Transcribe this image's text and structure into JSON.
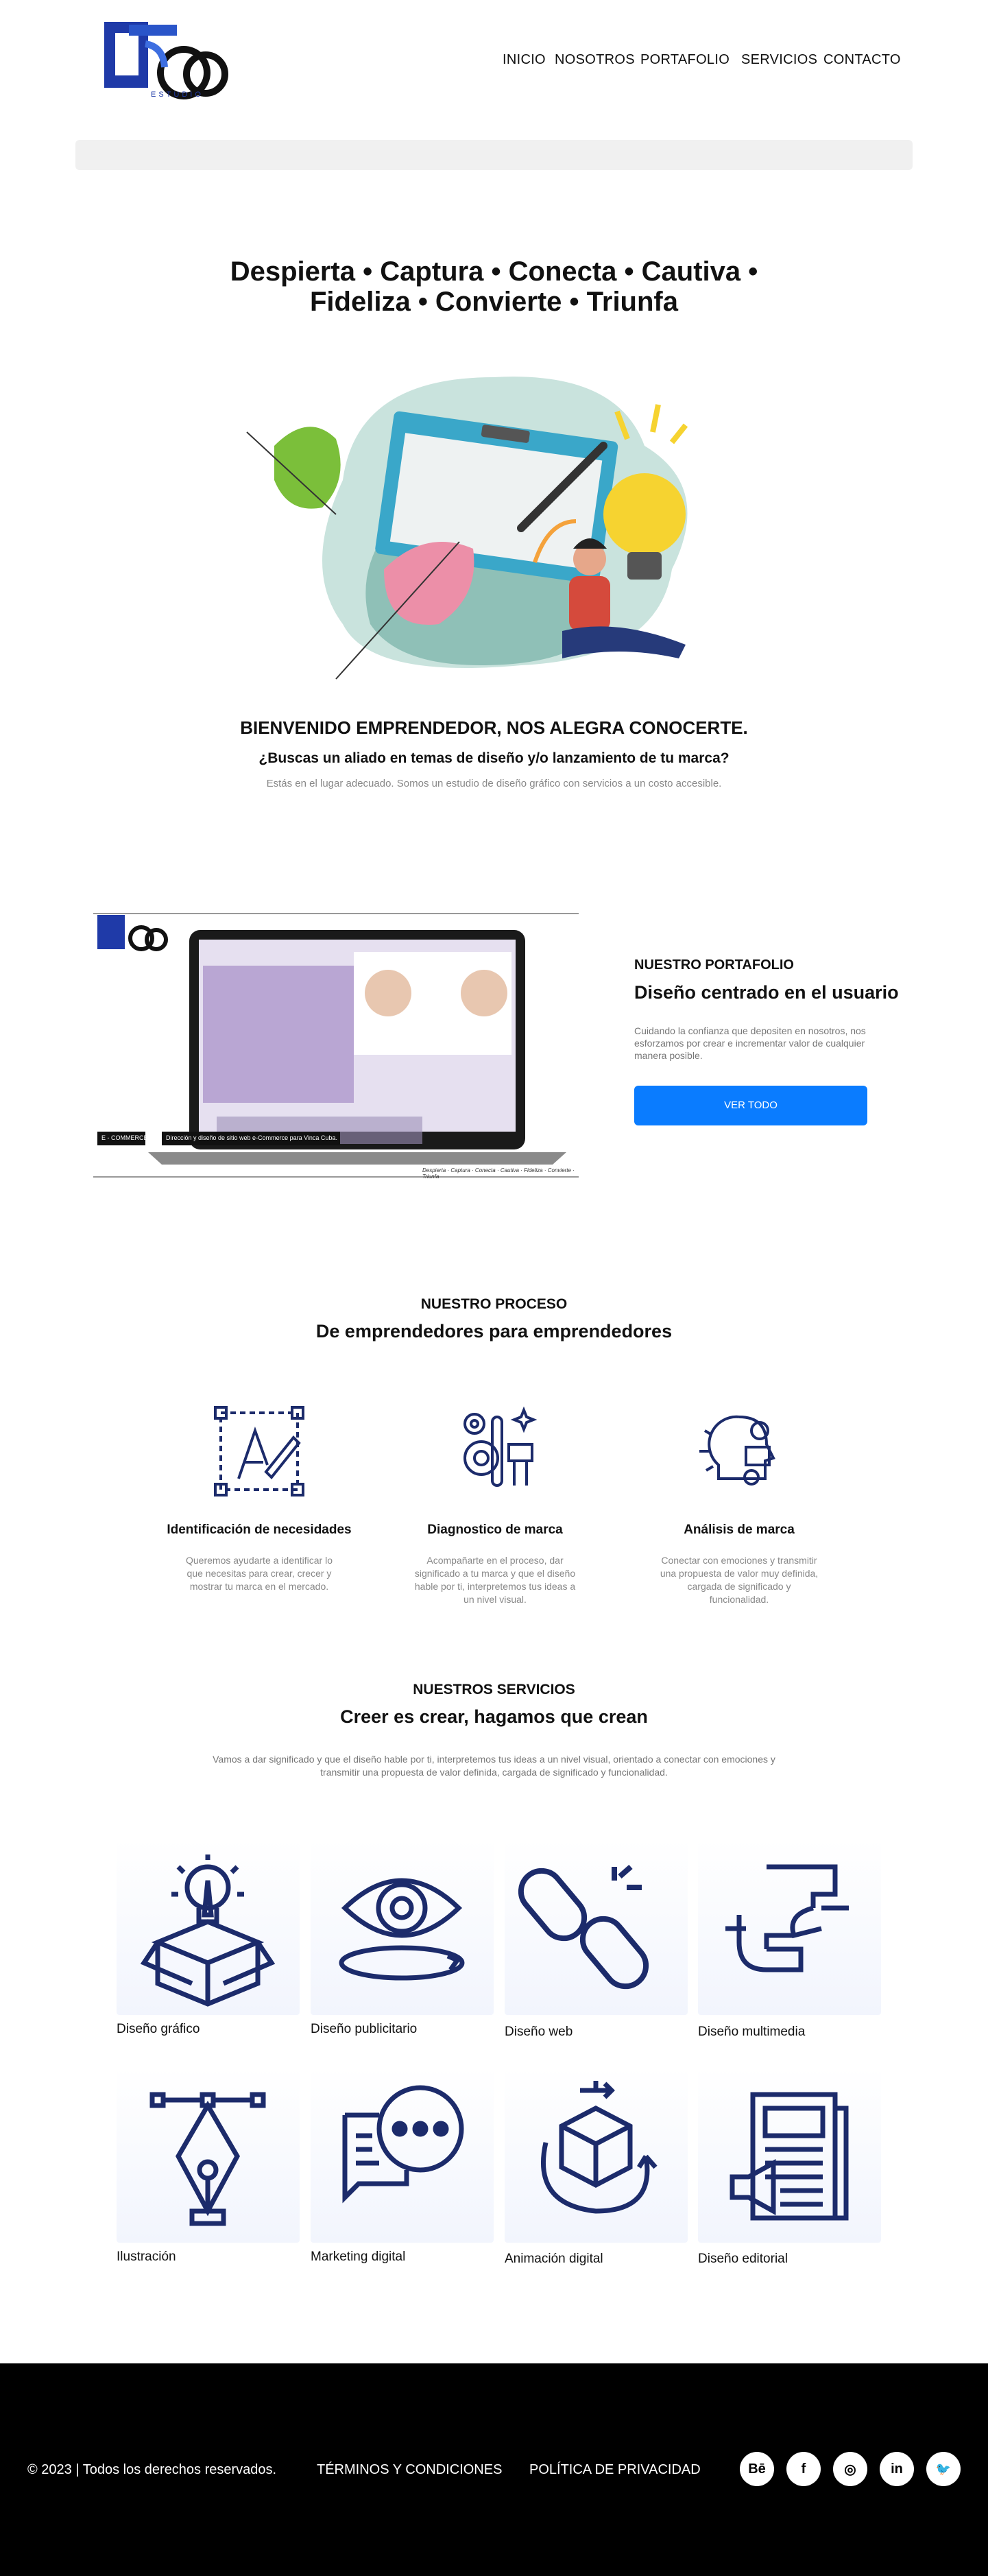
{
  "header": {
    "logo_text": "ESTUDIO",
    "nav": [
      "INICIO",
      "NOSOTROS",
      "PORTAFOLIO",
      "SERVICIOS",
      "CONTACTO"
    ]
  },
  "hero": {
    "title_line1": "Despierta • Captura • Conecta • Cautiva •",
    "title_line2": "Fideliza • Convierte • Triunfa",
    "welcome": "BIENVENIDO EMPRENDEDOR, NOS ALEGRA CONOCERTE.",
    "question": "¿Buscas un aliado en temas de diseño y/o lanzamiento de tu marca?",
    "text": "Estás en el lugar adecuado. Somos un estudio de diseño gráfico con servicios a un costo accesible."
  },
  "portfolio": {
    "kicker": "NUESTRO PORTAFOLIO",
    "title": "Diseño centrado en el usuario",
    "desc": "Cuidando la confianza que depositen en nosotros, nos esforzamos por crear e incrementar valor de cualquier manera posible.",
    "button": "VER TODO",
    "image_tag": "E - COMMERCE",
    "image_caption": "Dirección y diseño de sitio web e-Commerce para Vinca Cuba.",
    "image_signature": "Despierta · Captura · Conecta · Cautiva · Fideliza · Convierte · Triunfa"
  },
  "process": {
    "kicker": "NUESTRO PROCESO",
    "title": "De emprendedores para emprendedores",
    "steps": [
      {
        "title": "Identificación de necesidades",
        "text": "Queremos ayudarte a identificar lo que necesitas para crear, crecer y mostrar tu marca en el mercado.",
        "icon": "design-pen-icon"
      },
      {
        "title": "Diagnostico de marca",
        "text": "Acompañarte en el proceso, dar significado a tu marca y que el diseño hable por ti, interpretemos tus ideas a un nivel visual.",
        "icon": "brand-tools-icon"
      },
      {
        "title": "Análisis de marca",
        "text": "Conectar con emociones y transmitir una propuesta de valor muy definida, cargada de significado y funcionalidad.",
        "icon": "creative-mind-icon"
      }
    ]
  },
  "services": {
    "kicker": "NUESTROS SERVICIOS",
    "title": "Creer es crear, hagamos que crean",
    "desc": "Vamos a dar significado y que el diseño hable por ti, interpretemos tus ideas a un nivel visual, orientado a conectar con emociones y transmitir una propuesta de valor definida, cargada de significado y funcionalidad.",
    "items": [
      {
        "label": "Diseño gráfico",
        "icon": "idea-box-icon"
      },
      {
        "label": "Diseño publicitario",
        "icon": "eye-icon"
      },
      {
        "label": "Diseño web",
        "icon": "link-icon"
      },
      {
        "label": "Diseño multimedia",
        "icon": "frame-hands-icon"
      },
      {
        "label": "Ilustración",
        "icon": "pen-tool-icon"
      },
      {
        "label": "Marketing digital",
        "icon": "chat-bubbles-icon"
      },
      {
        "label": "Animación digital",
        "icon": "3d-cube-icon"
      },
      {
        "label": "Diseño editorial",
        "icon": "newspaper-icon"
      }
    ]
  },
  "footer": {
    "copyright": "© 2023 | Todos los derechos reservados.",
    "terms": "TÉRMINOS Y CONDICIONES",
    "privacy": "POLÍTICA DE PRIVACIDAD",
    "social": [
      {
        "icon": "behance-icon",
        "glyph": "Bē"
      },
      {
        "icon": "facebook-icon",
        "glyph": "f"
      },
      {
        "icon": "instagram-icon",
        "glyph": "◎"
      },
      {
        "icon": "linkedin-icon",
        "glyph": "in"
      },
      {
        "icon": "twitter-icon",
        "glyph": "🐦"
      }
    ]
  },
  "colors": {
    "accent": "#0a7cff",
    "icon": "#1c2b6b",
    "footer": "#000000",
    "searchbar": "#f0f0f0"
  }
}
